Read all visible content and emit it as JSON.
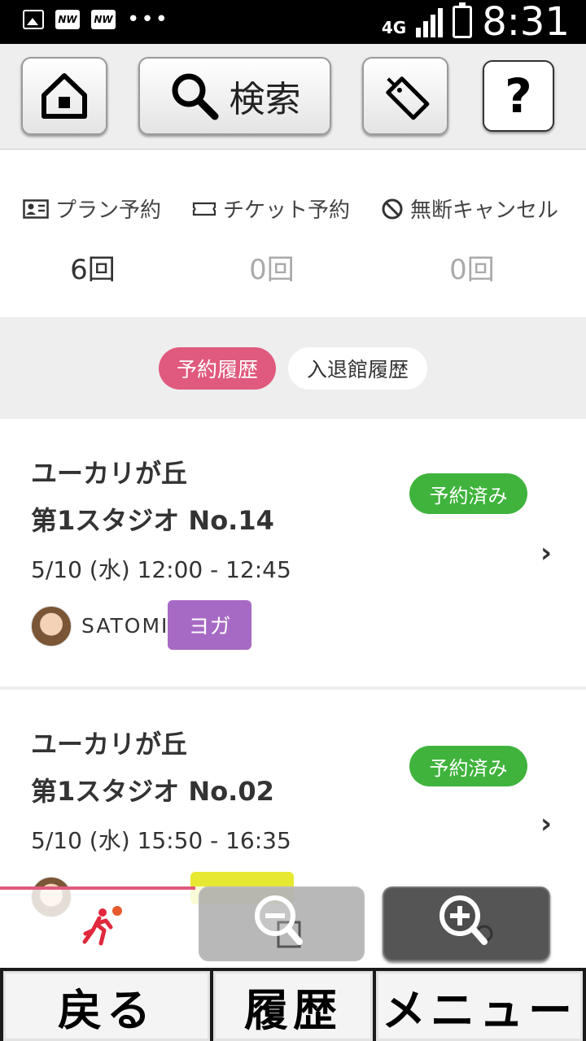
{
  "status_bar": {
    "network": "4G",
    "time": "8:31"
  },
  "toolbar": {
    "search_label": "検索",
    "help_label": "?"
  },
  "stats": [
    {
      "label": "プラン予約",
      "value": "6回",
      "icon": "id-card-icon"
    },
    {
      "label": "チケット予約",
      "value": "0回",
      "icon": "ticket-icon"
    },
    {
      "label": "無断キャンセル",
      "value": "0回",
      "icon": "prohibited-icon"
    }
  ],
  "history_tabs": [
    {
      "label": "予約履歴",
      "active": true
    },
    {
      "label": "入退館履歴",
      "active": false
    }
  ],
  "reservations": [
    {
      "location": "ユーカリが丘",
      "studio": "第1スタジオ  No.14",
      "datetime": "5/10 (水)  12:00 - 12:45",
      "status": "予約済み",
      "instructor": "SATOMI",
      "category": "ヨガ",
      "category_color": "#a76ac4"
    },
    {
      "location": "ユーカリが丘",
      "studio": "第1スタジオ  No.02",
      "datetime": "5/10 (水)  15:50 - 16:35",
      "status": "予約済み",
      "category_color": "#e6e832"
    }
  ],
  "bottom_nav": {
    "back": "戻る",
    "history": "履歴",
    "menu": "メニュー"
  },
  "colors": {
    "accent_pink": "#e05a7e",
    "status_green": "#3fb33c",
    "yoga_purple": "#a76ac4"
  }
}
